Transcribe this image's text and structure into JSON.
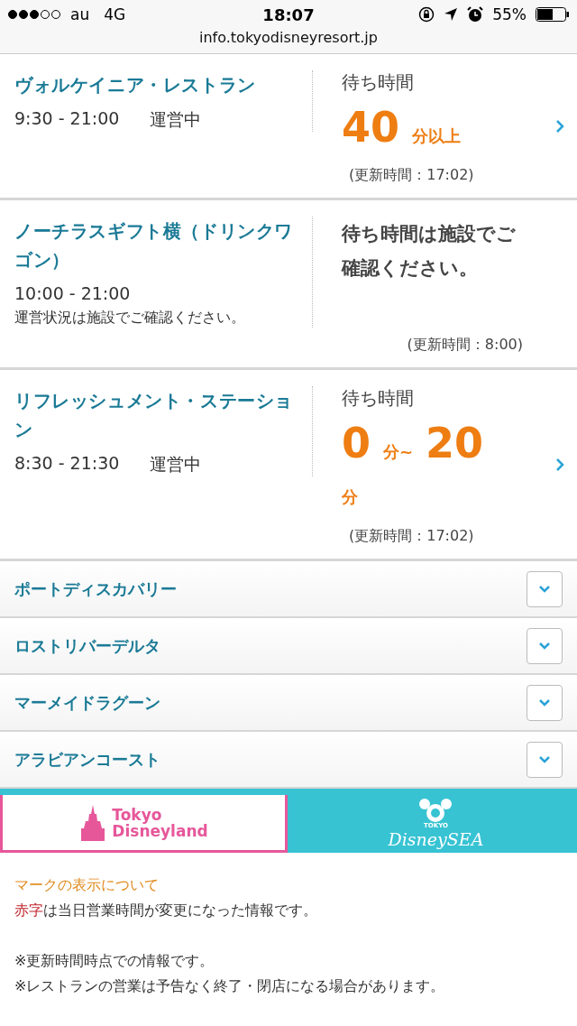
{
  "status_bar": {
    "carrier": "au",
    "network": "4G",
    "time": "18:07",
    "battery": "55%"
  },
  "url_bar": {
    "url": "info.tokyodisneyresort.jp"
  },
  "facilities": [
    {
      "kind": "wait",
      "name": "ヴォルケイニア・レストラン",
      "hours": "9:30 - 21:00",
      "status": "運営中",
      "wait_label": "待ち時間",
      "wait": [
        {
          "kind": "number",
          "text": "40"
        },
        {
          "kind": "unit",
          "text": "分以上"
        }
      ],
      "updated": "(更新時間：17:02)"
    },
    {
      "kind": "message",
      "name": "ノーチラスギフト横（ドリンクワゴン）",
      "hours": "10:00 - 21:00",
      "status": "運営状況は施設でご確認ください。",
      "message": "待ち時間は施設でご確認ください。",
      "updated": "(更新時間：8:00)"
    },
    {
      "kind": "wait",
      "name": "リフレッシュメント・ステーション",
      "hours": "8:30 - 21:30",
      "status": "運営中",
      "wait_label": "待ち時間",
      "wait": [
        {
          "kind": "number",
          "text": "0"
        },
        {
          "kind": "unit",
          "text": "分~"
        },
        {
          "kind": "number",
          "text": "20"
        },
        {
          "kind": "unit",
          "text": "分"
        }
      ],
      "updated": "(更新時間：17:02)"
    }
  ],
  "areas": [
    {
      "label": "ポートディスカバリー",
      "expanded": false
    },
    {
      "label": "ロストリバーデルタ",
      "expanded": false
    },
    {
      "label": "マーメイドラグーン",
      "expanded": false
    },
    {
      "label": "アラビアンコースト",
      "expanded": false
    }
  ],
  "park_tabs": [
    {
      "kind": "land",
      "lines": [
        "Tokyo",
        "Disneyland"
      ],
      "selected": true
    },
    {
      "kind": "sea",
      "small": "TOKYO",
      "main": "DisneySEA",
      "selected": false
    }
  ],
  "notes": {
    "title": "マークの表示について",
    "legend_highlight": "赤字",
    "legend_rest": "は当日営業時間が変更になった情報です。",
    "lines": [
      "※更新時間時点での情報です。",
      "※レストランの営業は予告なく終了・閉店になる場合があります。"
    ]
  }
}
